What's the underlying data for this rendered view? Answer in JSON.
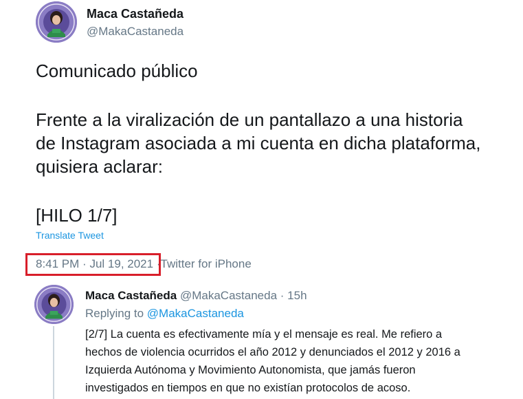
{
  "tweet": {
    "author_name": "Maca Castañeda",
    "author_handle": "@MakaCastaneda",
    "body_lines": [
      "Comunicado público",
      "Frente a la viralización de un pantallazo a una historia",
      "de Instagram asociada a mi cuenta en dicha plataforma,",
      "quisiera aclarar:",
      "[HILO 1/7]"
    ],
    "translate_label": "Translate Tweet",
    "time": "8:41 PM",
    "separator": "·",
    "date": "Jul 19, 2021",
    "source": "Twitter for iPhone"
  },
  "reply": {
    "author_name": "Maca Castañeda",
    "author_handle": "@MakaCastaneda",
    "separator": "·",
    "age": "15h",
    "replying_to_label": "Replying to",
    "replying_to_handle": "@MakaCastaneda",
    "body_lines": [
      "[2/7] La cuenta es efectivamente mía y el mensaje es real. Me refiero a",
      "hechos de violencia ocurridos el año 2012 y denunciados el 2012 y 2016 a",
      "Izquierda Autónoma y Movimiento Autonomista, que jamás fueron",
      "investigados en tiempos en que no existían protocolos de acoso."
    ]
  },
  "colors": {
    "text_primary": "#14171a",
    "text_secondary": "#657786",
    "link": "#1b95e0",
    "highlight_box": "#d81e2a",
    "avatar_bg": "#7b6bb8",
    "thread_line": "#ccd6dd"
  }
}
